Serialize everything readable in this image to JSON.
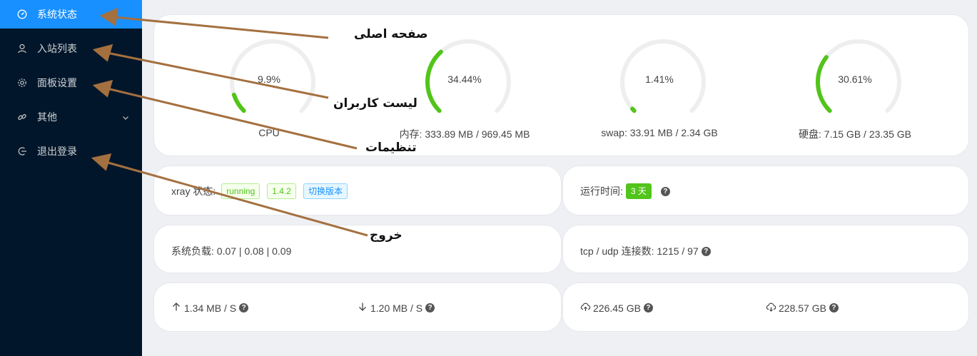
{
  "sidebar": {
    "items": [
      {
        "label": "系统状态",
        "icon": "dashboard-icon",
        "active": true
      },
      {
        "label": "入站列表",
        "icon": "user-icon"
      },
      {
        "label": "面板设置",
        "icon": "gear-icon"
      },
      {
        "label": "其他",
        "icon": "link-icon",
        "has_submenu": true
      },
      {
        "label": "退出登录",
        "icon": "logout-icon"
      }
    ]
  },
  "gauges": [
    {
      "name": "cpu",
      "percent": 9.9,
      "percent_text": "9.9%",
      "label": "CPU"
    },
    {
      "name": "memory",
      "percent": 34.44,
      "percent_text": "34.44%",
      "label": "内存: 333.89 MB / 969.45 MB"
    },
    {
      "name": "swap",
      "percent": 1.41,
      "percent_text": "1.41%",
      "label": "swap: 33.91 MB / 2.34 GB"
    },
    {
      "name": "disk",
      "percent": 30.61,
      "percent_text": "30.61%",
      "label": "硬盘: 7.15 GB / 23.35 GB"
    }
  ],
  "xray": {
    "label": "xray 状态:",
    "state": "running",
    "version": "1.4.2",
    "switch_label": "切换版本"
  },
  "uptime": {
    "label": "运行时间:",
    "value": "3 天"
  },
  "load": {
    "text": "系统负载: 0.07 | 0.08 | 0.09"
  },
  "connections": {
    "text": "tcp / udp 连接数: 1215 / 97"
  },
  "network": {
    "upload_speed": "1.34 MB / S",
    "download_speed": "1.20 MB / S",
    "total_sent": "226.45 GB",
    "total_received": "228.57 GB"
  },
  "colors": {
    "accent": "#1890ff",
    "gauge": "#52c41a",
    "track": "#eeeeee",
    "sidebar": "#01162a",
    "arrow": "#a4703f"
  },
  "annotations": [
    {
      "text": "صفحه اصلی"
    },
    {
      "text": "لیست کاربران"
    },
    {
      "text": "تنظیمات"
    },
    {
      "text": "خروج"
    }
  ]
}
